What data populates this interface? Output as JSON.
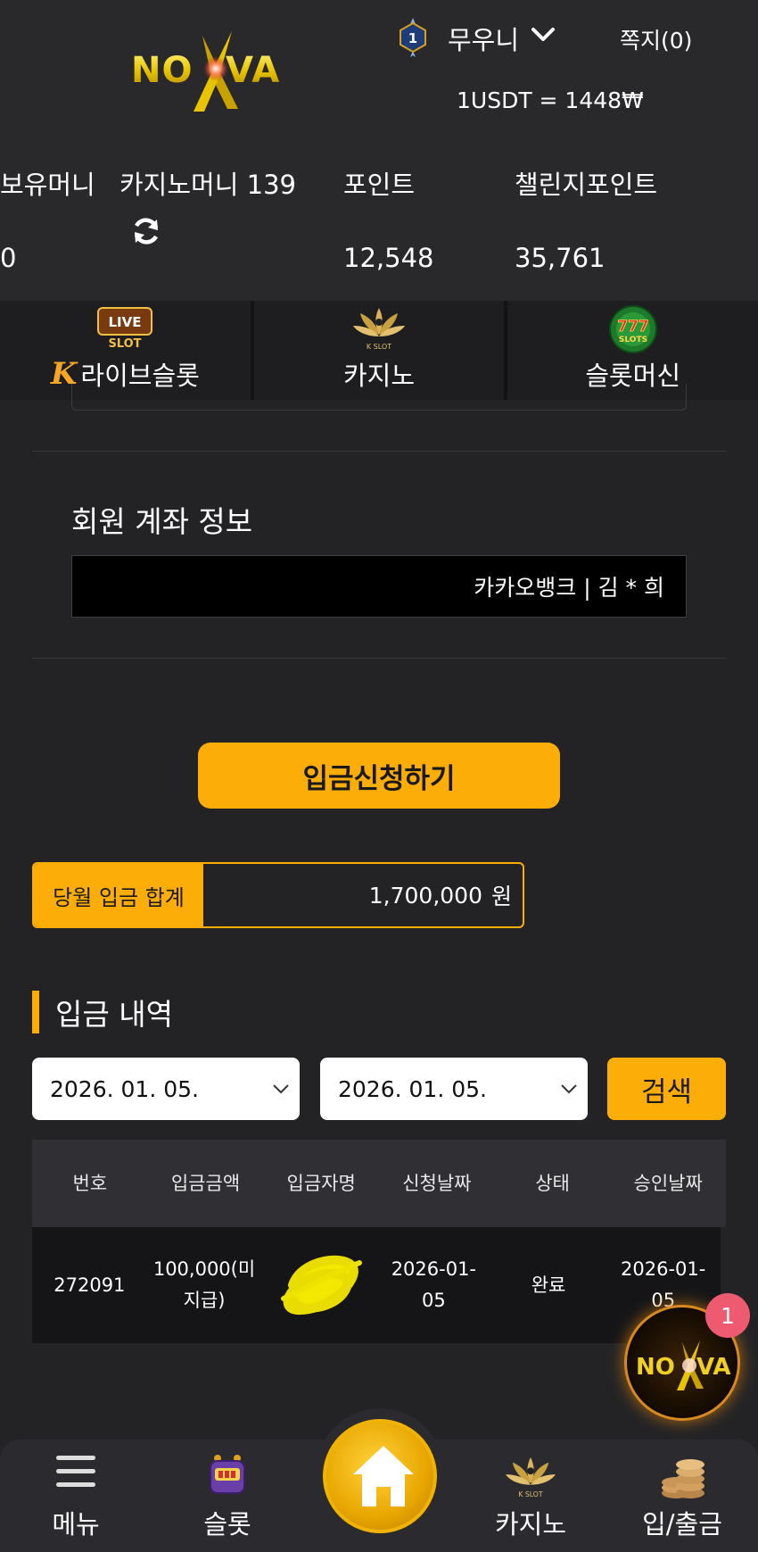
{
  "header": {
    "logo_text": "NOVA X",
    "level": "1",
    "username": "무우니",
    "messages_label": "쪽지(0)",
    "exchange_rate": "1USDT = 1448₩"
  },
  "balances": {
    "money_label": "보유머니",
    "money_value": "0",
    "casino_money_label": "카지노머니 139",
    "points_label": "포인트",
    "points_value": "12,548",
    "challenge_label": "챌린지포인트",
    "challenge_value": "35,761"
  },
  "category_tabs": [
    {
      "label": "라이브슬롯",
      "badge": "K",
      "icon": "live-slot-icon",
      "icon_text": [
        "LIVE",
        "SLOT"
      ]
    },
    {
      "label": "카지노",
      "icon": "k-slot-lotus-icon",
      "icon_text": "K SLOT"
    },
    {
      "label": "슬롯머신",
      "icon": "777-slots-icon",
      "icon_text": [
        "777",
        "SLOTS"
      ]
    }
  ],
  "account": {
    "title": "회원 계좌 정보",
    "value": "카카오뱅크 | 김 * 희"
  },
  "deposit_button": "입금신청하기",
  "monthly": {
    "label": "당월 입금 합계",
    "amount": "1,700,000",
    "unit": "원"
  },
  "history": {
    "title": "입금 내역",
    "date_from": "2026. 01. 05.",
    "date_to": "2026. 01. 05.",
    "search_label": "검색",
    "columns": [
      "번호",
      "입금금액",
      "입금자명",
      "신청날짜",
      "상태",
      "승인날짜"
    ],
    "rows": [
      {
        "no": "272091",
        "amount_line1": "100,000(미",
        "amount_line2": "지급)",
        "requested_line1": "2026-01-",
        "requested_line2": "05",
        "status": "완료",
        "approved_line1": "2026-01-",
        "approved_line2": "05"
      }
    ]
  },
  "floating": {
    "badge": "1",
    "logo_text": "NOVA X"
  },
  "bottom_nav": {
    "menu": "메뉴",
    "slot": "슬롯",
    "casino": "카지노",
    "deposit_withdraw": "입/출금"
  },
  "colors": {
    "accent": "#fdad08",
    "background": "#232326",
    "header": "#29292c",
    "badge": "#ee5a6f"
  }
}
